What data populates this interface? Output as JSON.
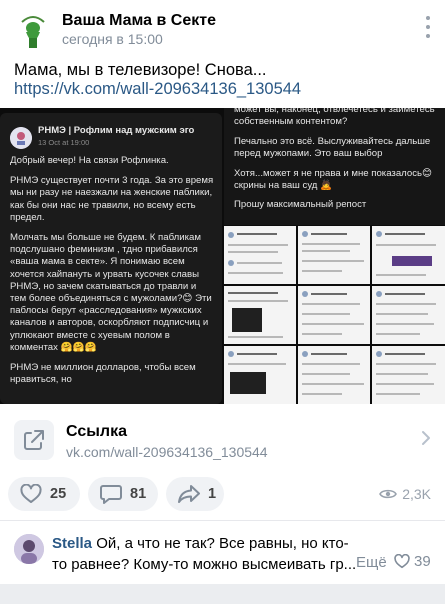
{
  "post": {
    "group_name": "Ваша Мама в Секте",
    "time": "сегодня в 15:00",
    "text": "Мама, мы в телевизоре! Снова...",
    "link": "https://vk.com/wall-209634136_130544"
  },
  "media": {
    "card": {
      "author": "РНМЭ | Рофлим над мужским эго",
      "date": "13 Oct at 19:00",
      "paragraphs": [
        "Добрый вечер! На связи Рофлинка.",
        "РНМЭ существует почти 3 года. За это время мы ни разу не наезжали на женские паблики, как бы они нас не травили, но всему есть предел.",
        "Молчать мы больше не будем. К пабликам подслушано феминизм , тдно прибавился «ваша мама в секте». Я понимаю всем хочется хайпануть и урвать кусочек славы РНМЭ, но зачем скатываться до травли и тем более объединяться с мужолами?😊 Эти паблосы берут «расследования» мужкских каналов и авторов, оскорбляют подписчиц и уплюкают вместе с хуевым полом в комментах 🤗🤗🤗",
        "РНМЭ не миллион долларов, чтобы всем нравиться, но"
      ]
    },
    "right": {
      "lines": [
        "может вы, наконец, отвлечетесь и займетесь собственным контентом?",
        "Печально это всё. Выслуживайтесь дальше перед мужопами. Это ваш выбор",
        "Хотя...может я не права и мне показалось😊 скрины на ваш суд 🙇",
        "Прошу максимальный репост"
      ]
    }
  },
  "snippet": {
    "title": "Ссылка",
    "url": "vk.com/wall-209634136_130544"
  },
  "actions": {
    "likes": "25",
    "comments": "81",
    "shares": "1",
    "views": "2,3K"
  },
  "comment": {
    "author": "Stella",
    "text": "Ой, а что не так? Все равны, но кто-то равнее? Кому-то можно высмеивать гр...",
    "more_label": "Ещё",
    "likes": "39"
  },
  "colors": {
    "link": "#2a5885",
    "secondary": "#818c99",
    "pill_bg": "#f0f2f5",
    "dark_media": "#1b1b1b"
  }
}
